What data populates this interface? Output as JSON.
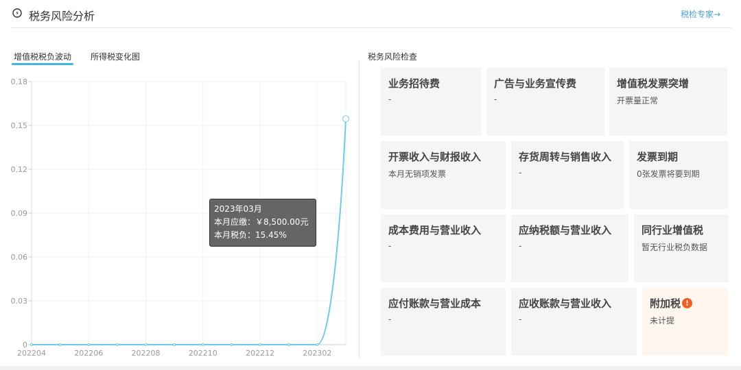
{
  "header": {
    "title": "税务风险分析",
    "expert_link": "税检专家→"
  },
  "left_panel": {
    "tabs": [
      {
        "label": "增值税税负波动",
        "active": true
      },
      {
        "label": "所得税变化图",
        "active": false
      }
    ],
    "tooltip": {
      "period": "2023年03月",
      "payable": "本月应缴：￥8,500.00元",
      "burden": "本月税负：15.45%"
    }
  },
  "chart_data": {
    "type": "line",
    "x": [
      "202204",
      "202205",
      "202206",
      "202207",
      "202208",
      "202209",
      "202210",
      "202211",
      "202212",
      "202301",
      "202302",
      "202303"
    ],
    "x_tick_labels": [
      "202204",
      "202206",
      "202208",
      "202210",
      "202212",
      "202302"
    ],
    "series": [
      {
        "values": [
          0,
          0,
          0,
          0,
          0,
          0,
          0,
          0,
          0,
          0,
          0,
          0.1545
        ]
      }
    ],
    "y_ticks": [
      "0",
      "0.03",
      "0.06",
      "0.09",
      "0.12",
      "0.15",
      "0.18"
    ],
    "ylim": [
      0,
      0.18
    ],
    "grid": true,
    "colors": {
      "line": "#6ccbe8",
      "grid": "#e8f3f6",
      "tick": "#999999"
    }
  },
  "risk_check": {
    "title": "税务风险检查",
    "cards": [
      {
        "title": "业务招待费",
        "value": "-"
      },
      {
        "title": "广告与业务宣传费",
        "value": "-"
      },
      {
        "title": "增值税发票突增",
        "value": "开票量正常"
      },
      {
        "title": "开票收入与财报收入",
        "value": "本月无销项发票"
      },
      {
        "title": "存货周转与销售收入",
        "value": "-"
      },
      {
        "title": "发票到期",
        "value": "0张发票将要到期"
      },
      {
        "title": "成本费用与营业收入",
        "value": "-"
      },
      {
        "title": "应纳税额与营业收入",
        "value": "-"
      },
      {
        "title": "同行业增值税",
        "value": "暂无行业税负数据"
      },
      {
        "title": "应付账款与营业成本",
        "value": "-"
      },
      {
        "title": "应收账款与营业收入",
        "value": "-"
      },
      {
        "title": "附加税",
        "value": "未计提",
        "warning": true,
        "icon": "alert-icon"
      }
    ]
  },
  "colors": {
    "accent": "#3cb8e4",
    "link": "#4aa3d8",
    "warning": "#f25c1f"
  }
}
